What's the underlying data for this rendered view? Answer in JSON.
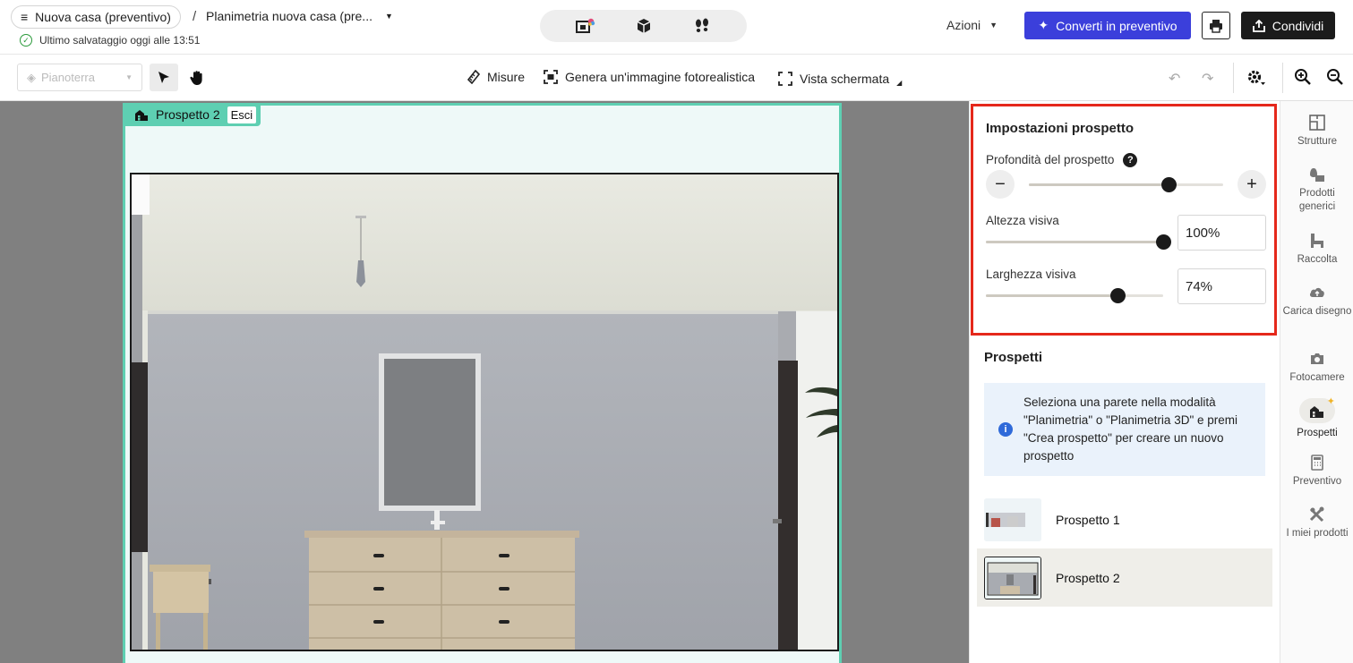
{
  "topbar": {
    "project_name": "Nuova casa (preventivo)",
    "separator": "/",
    "plan_name": "Planimetria nuova casa (pre...",
    "save_status": "Ultimo salvataggio oggi alle 13:51",
    "actions_label": "Azioni",
    "convert_label": "Converti in preventivo",
    "share_label": "Condividi",
    "view_modes": [
      "2d-plan-icon",
      "3d-box-icon",
      "walkthrough-footprints-icon"
    ]
  },
  "toolbar": {
    "floor": "Pianoterra",
    "measures": "Misure",
    "render": "Genera un'immagine fotorealistica",
    "screenshot": "Vista schermata"
  },
  "canvas": {
    "elevation_tag": "Prospetto 2",
    "exit_label": "Esci"
  },
  "settings": {
    "title": "Impostazioni prospetto",
    "depth_label": "Profondità del prospetto",
    "depth_value": 0.72,
    "height_label": "Altezza visiva",
    "height_value": "100%",
    "height_fraction": 1.0,
    "width_label": "Larghezza visiva",
    "width_value": "74%",
    "width_fraction": 0.74
  },
  "elevations": {
    "title": "Prospetti",
    "info": "Seleziona una parete nella modalità \"Planimetria\" o \"Planimetria 3D\" e premi \"Crea prospetto\" per creare un nuovo prospetto",
    "items": [
      {
        "name": "Prospetto 1",
        "active": false
      },
      {
        "name": "Prospetto 2",
        "active": true
      }
    ]
  },
  "rail": {
    "items": [
      {
        "label": "Strutture",
        "icon": "structures-icon"
      },
      {
        "label": "Prodotti generici",
        "icon": "generic-products-icon"
      },
      {
        "label": "Raccolta",
        "icon": "collection-icon"
      },
      {
        "label": "Carica disegno",
        "icon": "upload-drawing-icon"
      },
      {
        "label": "Fotocamere",
        "icon": "camera-icon"
      },
      {
        "label": "Prospetti",
        "icon": "elevation-icon"
      },
      {
        "label": "Preventivo",
        "icon": "calculator-icon"
      },
      {
        "label": "I miei prodotti",
        "icon": "my-products-icon"
      }
    ]
  },
  "colors": {
    "accent_blue": "#3b3fdb",
    "elevation_teal": "#5ecfb2",
    "highlight_red": "#e5281b"
  }
}
